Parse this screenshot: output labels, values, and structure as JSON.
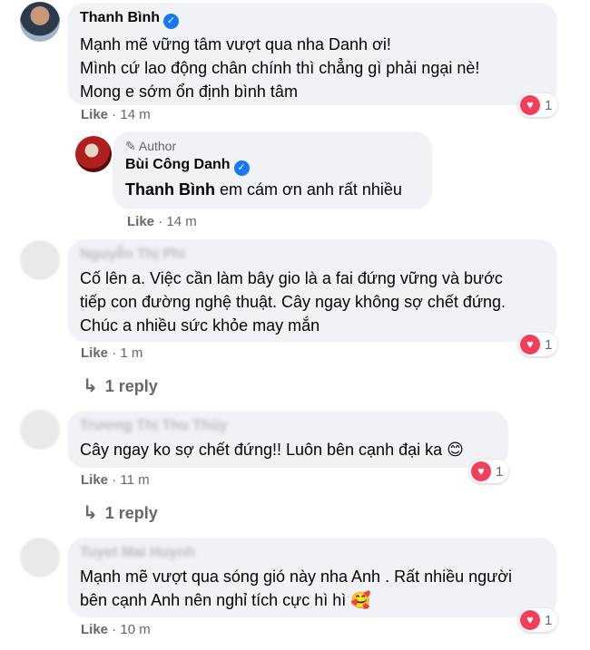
{
  "comments": [
    {
      "name": "Thanh Bình",
      "verified": true,
      "lines": [
        "Mạnh mẽ vững tâm vượt qua nha Danh ơi!",
        "Mình cứ lao động chân chính thì chẳng gì phải ngại nè!",
        "Mong e sớm ổn định bình tâm"
      ],
      "like": "Like",
      "sep": "·",
      "time": "14 m",
      "reactions": "1"
    },
    {
      "author_label": "Author",
      "name": "Bùi Công Danh",
      "verified": true,
      "mention": "Thanh Bình",
      "text": " em cám ơn anh rất nhiều",
      "like": "Like",
      "sep": "·",
      "time": "14 m"
    },
    {
      "name": "Nguyễn Thị Phi",
      "lines": [
        "Cố lên a. Việc cần làm bây gio là a fai đứng vững và bước",
        "tiếp con đường nghệ thuật. Cây ngay không sợ chết đứng.",
        "Chúc a nhiều sức khỏe may mắn"
      ],
      "like": "Like",
      "sep": "·",
      "time": "1 m",
      "reactions": "1",
      "reply": "1 reply"
    },
    {
      "name": "Trương Thị Thu Thủy",
      "text": "Cây ngay ko sợ chết đứng!! Luôn bên cạnh đại ka",
      "emoji": "😊",
      "like": "Like",
      "sep": "·",
      "time": "11 m",
      "reactions": "1",
      "reply": "1 reply"
    },
    {
      "name": "Tuyet Mai Huynh",
      "lines": [
        "Mạnh mẽ vượt qua sóng gió này nha Anh . Rất nhiều người",
        "bên cạnh Anh nên nghỉ tích cực hì hì"
      ],
      "emoji": "🥰",
      "like": "Like",
      "sep": "·",
      "time": "10 m",
      "reactions": "1"
    }
  ],
  "icons": {
    "verified": "verified-badge-icon",
    "heart": "heart-reaction-icon",
    "reply": "reply-arrow-icon",
    "author": "pen-author-icon"
  },
  "colors": {
    "bubble": "#f0f2f5",
    "meta": "#65676b",
    "verified": "#1877f2",
    "heart": "#f33e58"
  }
}
